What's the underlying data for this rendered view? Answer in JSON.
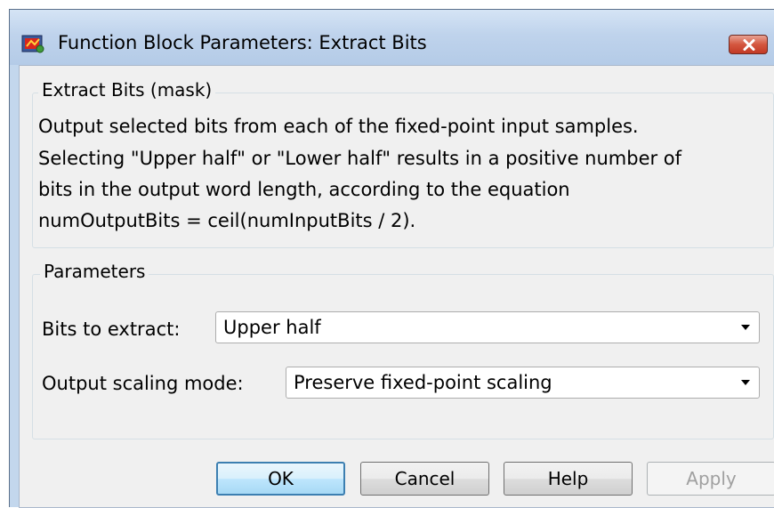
{
  "window": {
    "title": "Function Block Parameters: Extract Bits",
    "app_icon": "simulink-block-icon",
    "close_icon": "close-icon"
  },
  "description": {
    "legend": "Extract Bits (mask)",
    "lines": [
      "Output selected bits from each of the fixed-point input samples.",
      "Selecting \"Upper half\" or \"Lower half\" results in a positive number of",
      "bits in the output word length, according to the equation",
      "numOutputBits = ceil(numInputBits / 2)."
    ]
  },
  "parameters": {
    "legend": "Parameters",
    "bits_to_extract": {
      "label": "Bits to extract:",
      "value": "Upper half"
    },
    "output_scaling_mode": {
      "label": "Output scaling mode:",
      "value": "Preserve fixed-point scaling"
    }
  },
  "buttons": {
    "ok": "OK",
    "cancel": "Cancel",
    "help": "Help",
    "apply": "Apply"
  }
}
